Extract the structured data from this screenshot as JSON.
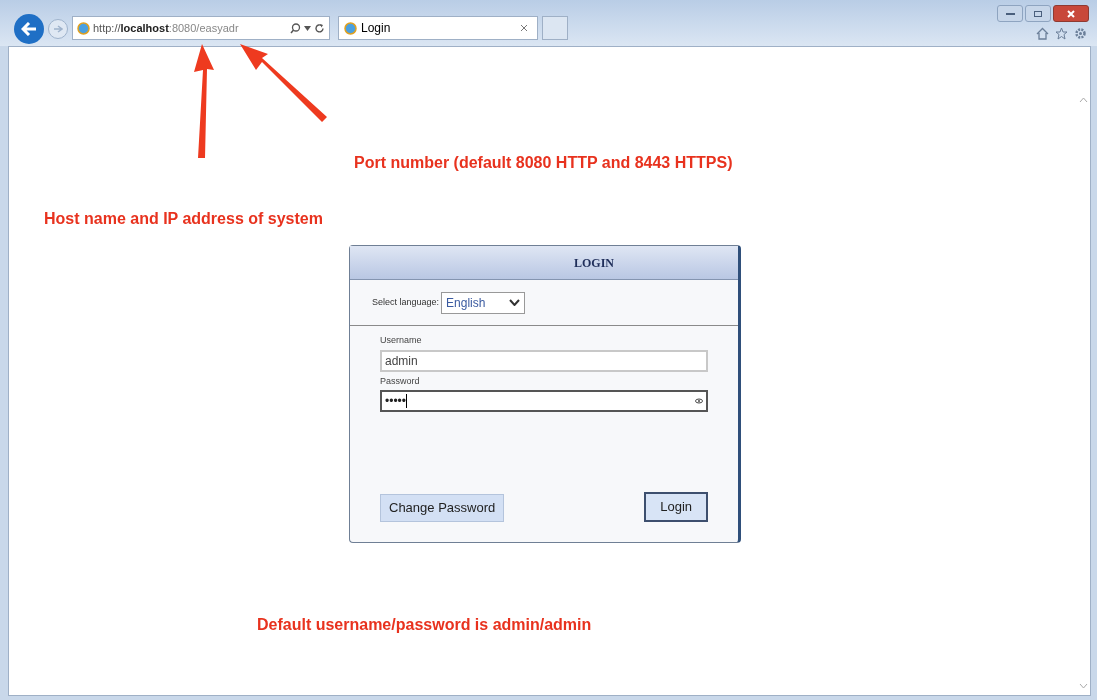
{
  "browser": {
    "url_parts": [
      {
        "kind": "scheme",
        "text": "http://"
      },
      {
        "kind": "host",
        "text": "localhost"
      },
      {
        "kind": "rest",
        "text": ":8080/easyadr"
      }
    ],
    "tab": {
      "title": "Login",
      "selected": true
    }
  },
  "annotations": [
    {
      "kind": "port",
      "text": "Port number (default 8080 HTTP and 8443 HTTPS)"
    },
    {
      "kind": "host",
      "text": "Host name and IP address of system"
    },
    {
      "kind": "credentials",
      "text": "Default username/password is admin/admin"
    }
  ],
  "login": {
    "title": "LOGIN",
    "language_label": "Select language:",
    "language": "English",
    "username_label": "Username",
    "username": "admin",
    "password_label": "Password",
    "password": "•••••",
    "buttons": [
      {
        "kind": "secondary",
        "label": "Change Password"
      },
      {
        "kind": "primary",
        "label": "Login"
      }
    ]
  }
}
